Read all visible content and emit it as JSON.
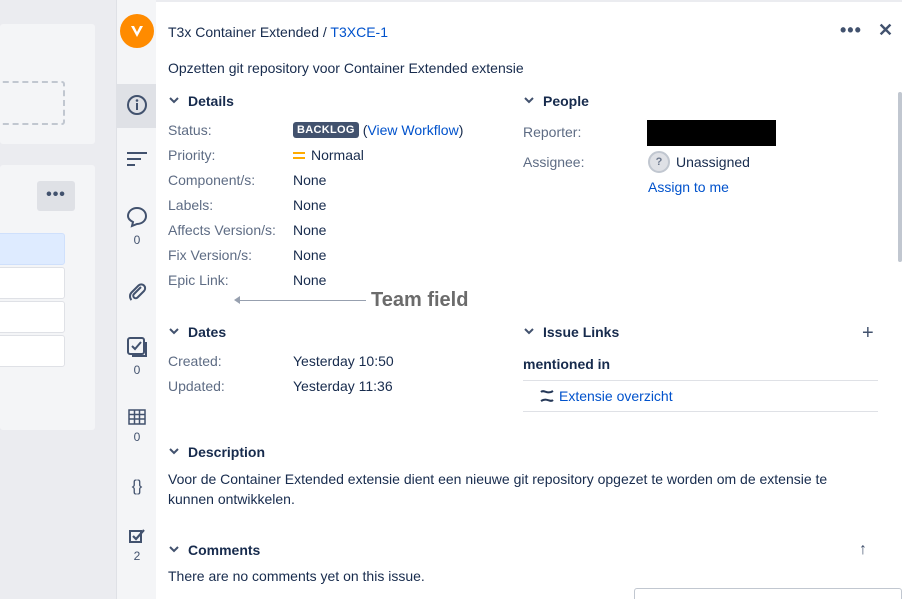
{
  "breadcrumb": {
    "project": "T3x Container Extended",
    "separator": "/",
    "issue_key": "T3XCE-1"
  },
  "summary": "Opzetten git repository voor Container Extended extensie",
  "rail": {
    "comments_count": "0",
    "checklist_count": "0",
    "table_count": "0",
    "tasks_count": "2"
  },
  "details": {
    "heading": "Details",
    "status_label": "Status:",
    "status_badge": "BACKLOG",
    "status_open": "(",
    "view_workflow": "View Workflow",
    "status_close": ")",
    "priority_label": "Priority:",
    "priority_value": "Normaal",
    "components_label": "Component/s:",
    "components_value": "None",
    "labels_label": "Labels:",
    "labels_value": "None",
    "affects_label": "Affects Version/s:",
    "affects_value": "None",
    "fixversion_label": "Fix Version/s:",
    "fixversion_value": "None",
    "epic_label": "Epic Link:",
    "epic_value": "None"
  },
  "annotation": "Team field",
  "people": {
    "heading": "People",
    "reporter_label": "Reporter:",
    "assignee_label": "Assignee:",
    "assignee_value": "Unassigned",
    "assign_to_me": "Assign to me"
  },
  "dates": {
    "heading": "Dates",
    "created_label": "Created:",
    "created_value": "Yesterday 10:50",
    "updated_label": "Updated:",
    "updated_value": "Yesterday 11:36"
  },
  "issue_links": {
    "heading": "Issue Links",
    "relation": "mentioned in",
    "link_text": "Extensie overzicht"
  },
  "description": {
    "heading": "Description",
    "text": "Voor de Container Extended extensie dient een nieuwe git repository opgezet te worden om de extensie te kunnen ontwikkelen."
  },
  "comments": {
    "heading": "Comments",
    "empty_text": "There are no comments yet on this issue."
  },
  "colors": {
    "brand_orange": "#ff8b00",
    "link_blue": "#0052cc",
    "badge_dark": "#42526e"
  }
}
